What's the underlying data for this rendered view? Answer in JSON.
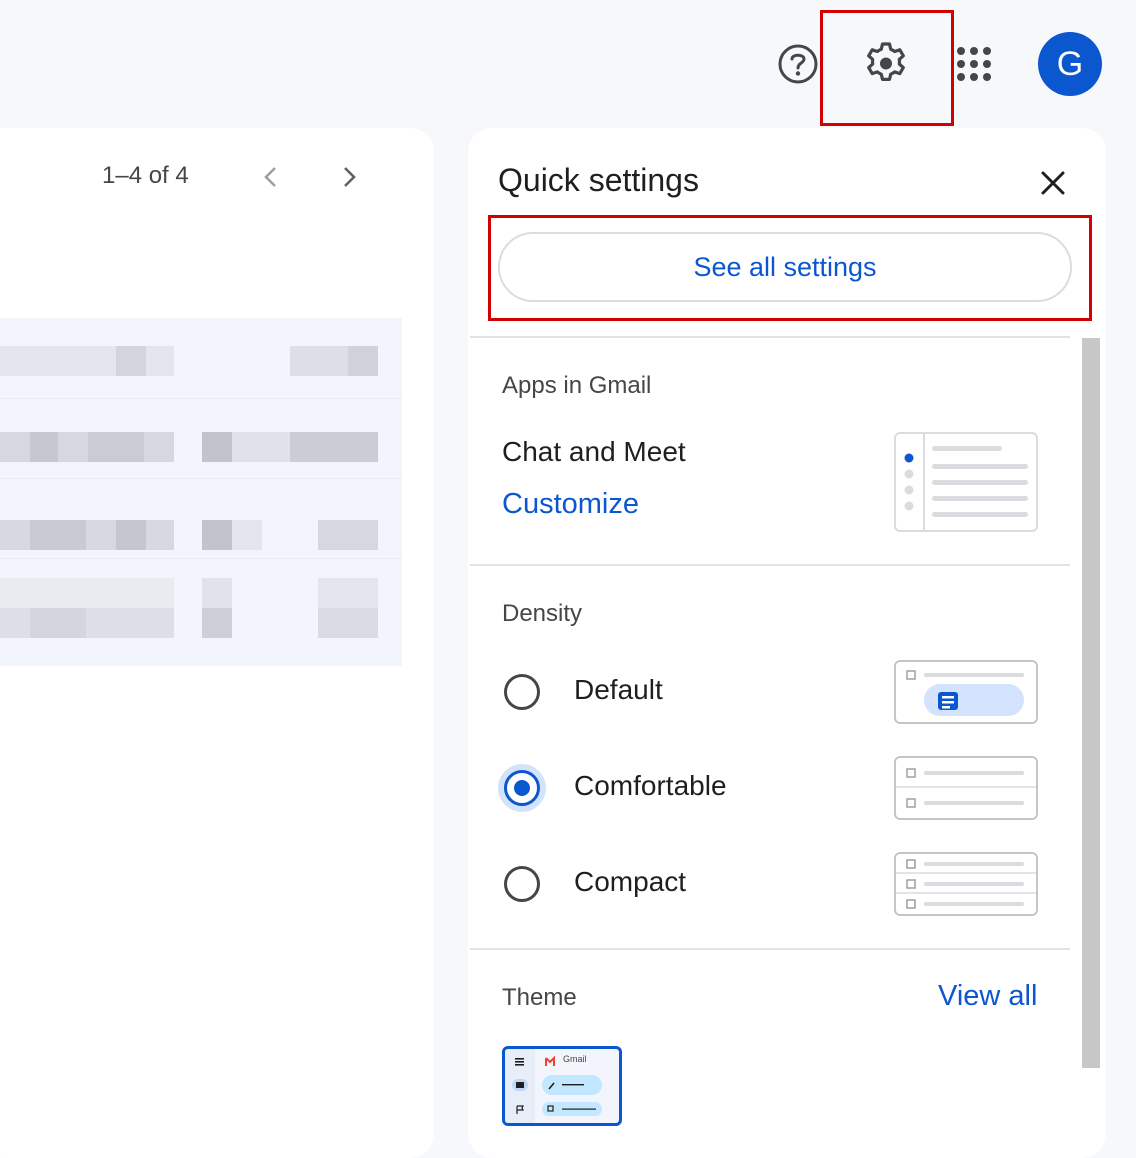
{
  "header": {
    "avatar_letter": "G",
    "icons": [
      "help-icon",
      "settings-gear-icon",
      "apps-grid-icon"
    ]
  },
  "mail_list": {
    "pagination": "1–4 of 4"
  },
  "quick_settings": {
    "title": "Quick settings",
    "see_all_label": "See all settings",
    "apps_section": {
      "label": "Apps in Gmail",
      "item": "Chat and Meet",
      "action": "Customize"
    },
    "density": {
      "label": "Density",
      "options": [
        {
          "label": "Default",
          "selected": false
        },
        {
          "label": "Comfortable",
          "selected": true
        },
        {
          "label": "Compact",
          "selected": false
        }
      ]
    },
    "theme": {
      "label": "Theme",
      "view_all": "View all",
      "thumbnail_app_name": "Gmail"
    }
  },
  "colors": {
    "accent": "#0b57d0",
    "highlight": "#d20000",
    "background": "#f6f8fc"
  }
}
